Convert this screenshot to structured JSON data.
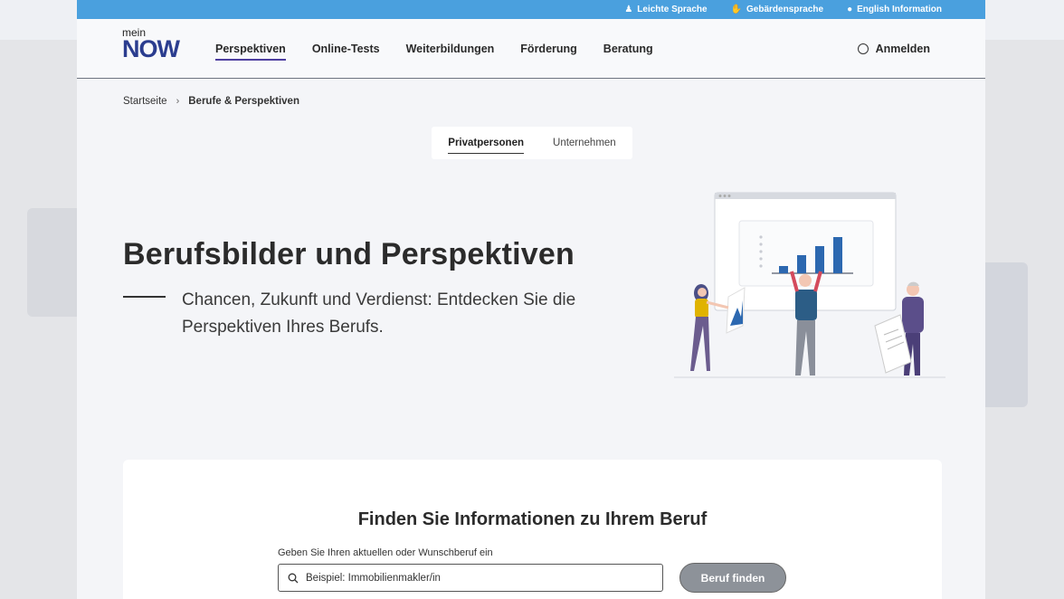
{
  "topbar": {
    "items": [
      {
        "label": "Leichte Sprache",
        "icon": "person-icon"
      },
      {
        "label": "Gebärdensprache",
        "icon": "hand-icon"
      },
      {
        "label": "English Information",
        "icon": "globe-icon"
      }
    ]
  },
  "logo": {
    "small": "mein",
    "big": "NOW"
  },
  "nav": {
    "items": [
      {
        "label": "Perspektiven",
        "active": true
      },
      {
        "label": "Online-Tests"
      },
      {
        "label": "Weiterbildungen"
      },
      {
        "label": "Förderung"
      },
      {
        "label": "Beratung"
      }
    ],
    "login": "Anmelden"
  },
  "breadcrumb": {
    "home": "Startseite",
    "current": "Berufe & Perspektiven"
  },
  "tabs": [
    {
      "label": "Privatpersonen",
      "active": true
    },
    {
      "label": "Unternehmen"
    }
  ],
  "hero": {
    "title": "Berufsbilder und Perspektiven",
    "lead": "Chancen, Zukunft und Verdienst: Entdecken Sie die Perspektiven Ihres Berufs."
  },
  "search": {
    "heading": "Finden Sie Informationen zu Ihrem Beruf",
    "label": "Geben Sie Ihren aktuellen oder Wunschberuf ein",
    "placeholder": "Beispiel: Immobilienmakler/in",
    "button": "Beruf finden"
  },
  "colors": {
    "topbar": "#4aa0de",
    "brand": "#2b3d8f",
    "accent": "#4d3fa0",
    "bars": "#2c68b0"
  },
  "chart_bars": [
    0.2,
    0.5,
    0.75,
    1.0
  ]
}
